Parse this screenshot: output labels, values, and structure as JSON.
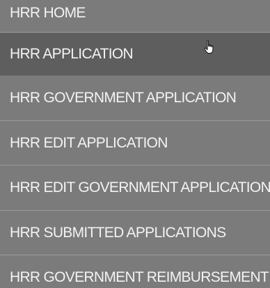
{
  "menu": {
    "items": [
      {
        "label": "HRR HOME"
      },
      {
        "label": "HRR APPLICATION",
        "active": true
      },
      {
        "label": "HRR GOVERNMENT APPLICATION"
      },
      {
        "label": "HRR EDIT APPLICATION"
      },
      {
        "label": "HRR EDIT GOVERNMENT APPLICATION"
      },
      {
        "label": "HRR SUBMITTED APPLICATIONS"
      },
      {
        "label": "HRR GOVERNMENT REIMBURSEMENT"
      }
    ]
  },
  "cursor": {
    "icon": "hand-pointer-icon"
  },
  "colors": {
    "background": "#7b7b7b",
    "active_background": "#5e5e5e",
    "text": "#f3f3f3",
    "divider": "#9a9a9a"
  }
}
